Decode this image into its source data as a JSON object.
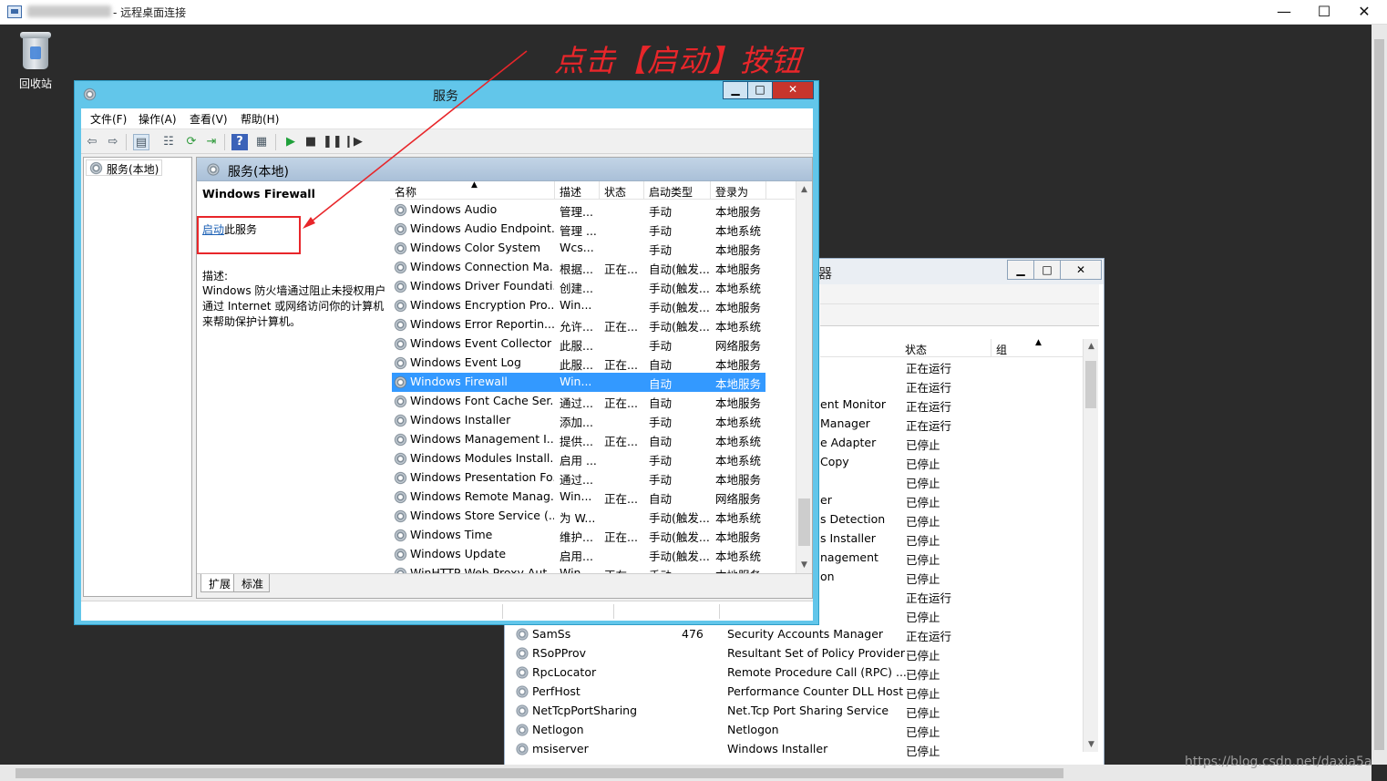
{
  "rdp": {
    "title": "- 远程桌面连接",
    "min": "—",
    "max": "☐",
    "close": "✕"
  },
  "desktop": {
    "recycle_bin_label": "回收站"
  },
  "annotation": {
    "text": "点击【启动】按钮",
    "color": "#e8262a"
  },
  "bg_window": {
    "title_fragment": "器",
    "min": "▁",
    "max": "□",
    "close": "✕",
    "col_status": "状态",
    "col_group": "组",
    "sort_arrow": "▲",
    "top_rows": [
      {
        "clip": "",
        "status": "正在运行"
      },
      {
        "clip": "",
        "status": "正在运行"
      },
      {
        "clip": "ent Monitor",
        "status": "正在运行"
      },
      {
        "clip": "Manager",
        "status": "正在运行"
      },
      {
        "clip": "e Adapter",
        "status": "已停止"
      },
      {
        "clip": "Copy",
        "status": "已停止"
      },
      {
        "clip": "",
        "status": "已停止"
      },
      {
        "clip": "er",
        "status": "已停止"
      },
      {
        "clip": "s Detection",
        "status": "已停止"
      },
      {
        "clip": "s Installer",
        "status": "已停止"
      },
      {
        "clip": "nagement",
        "status": "已停止"
      },
      {
        "clip": "on",
        "status": "已停止"
      },
      {
        "clip": "",
        "status": "正在运行"
      },
      {
        "clip": "",
        "status": "已停止"
      }
    ],
    "rows": [
      {
        "name": "SamSs",
        "pid": "476",
        "desc": "Security Accounts Manager",
        "status": "正在运行"
      },
      {
        "name": "RSoPProv",
        "pid": "",
        "desc": "Resultant Set of Policy Provider",
        "status": "已停止"
      },
      {
        "name": "RpcLocator",
        "pid": "",
        "desc": "Remote Procedure Call (RPC) ...",
        "status": "已停止"
      },
      {
        "name": "PerfHost",
        "pid": "",
        "desc": "Performance Counter DLL Host",
        "status": "已停止"
      },
      {
        "name": "NetTcpPortSharing",
        "pid": "",
        "desc": "Net.Tcp Port Sharing Service",
        "status": "已停止"
      },
      {
        "name": "Netlogon",
        "pid": "",
        "desc": "Netlogon",
        "status": "已停止"
      },
      {
        "name": "msiserver",
        "pid": "",
        "desc": "Windows Installer",
        "status": "已停止"
      }
    ]
  },
  "services": {
    "title": "服务",
    "min": "▁",
    "max": "□",
    "close": "✕",
    "menu": [
      "文件(F)",
      "操作(A)",
      "查看(V)",
      "帮助(H)"
    ],
    "tree_root": "服务(本地)",
    "pane_header": "服务(本地)",
    "detail": {
      "service_name": "Windows Firewall",
      "start_link": "启动",
      "start_suffix": "此服务",
      "desc_label": "描述:",
      "desc_text": "Windows 防火墙通过阻止未授权用户通过 Internet 或网络访问你的计算机来帮助保护计算机。"
    },
    "columns": {
      "name": "名称",
      "desc": "描述",
      "status": "状态",
      "startup": "启动类型",
      "logon": "登录为",
      "sort_arrow": "▲"
    },
    "rows": [
      {
        "name": "Windows Audio",
        "desc": "管理...",
        "status": "",
        "startup": "手动",
        "logon": "本地服务"
      },
      {
        "name": "Windows Audio Endpoint...",
        "desc": "管理 ...",
        "status": "",
        "startup": "手动",
        "logon": "本地系统"
      },
      {
        "name": "Windows Color System",
        "desc": "Wcs...",
        "status": "",
        "startup": "手动",
        "logon": "本地服务"
      },
      {
        "name": "Windows Connection Ma...",
        "desc": "根据...",
        "status": "正在...",
        "startup": "自动(触发...",
        "logon": "本地服务"
      },
      {
        "name": "Windows Driver Foundati...",
        "desc": "创建...",
        "status": "",
        "startup": "手动(触发...",
        "logon": "本地系统"
      },
      {
        "name": "Windows Encryption Pro...",
        "desc": "Win...",
        "status": "",
        "startup": "手动(触发...",
        "logon": "本地服务"
      },
      {
        "name": "Windows Error Reportin...",
        "desc": "允许...",
        "status": "正在...",
        "startup": "手动(触发...",
        "logon": "本地系统"
      },
      {
        "name": "Windows Event Collector",
        "desc": "此服...",
        "status": "",
        "startup": "手动",
        "logon": "网络服务"
      },
      {
        "name": "Windows Event Log",
        "desc": "此服...",
        "status": "正在...",
        "startup": "自动",
        "logon": "本地服务"
      },
      {
        "name": "Windows Firewall",
        "desc": "Win...",
        "status": "",
        "startup": "自动",
        "logon": "本地服务"
      },
      {
        "name": "Windows Font Cache Ser...",
        "desc": "通过...",
        "status": "正在...",
        "startup": "自动",
        "logon": "本地服务"
      },
      {
        "name": "Windows Installer",
        "desc": "添加...",
        "status": "",
        "startup": "手动",
        "logon": "本地系统"
      },
      {
        "name": "Windows Management I...",
        "desc": "提供...",
        "status": "正在...",
        "startup": "自动",
        "logon": "本地系统"
      },
      {
        "name": "Windows Modules Install...",
        "desc": "启用 ...",
        "status": "",
        "startup": "手动",
        "logon": "本地系统"
      },
      {
        "name": "Windows Presentation Fo...",
        "desc": "通过...",
        "status": "",
        "startup": "手动",
        "logon": "本地服务"
      },
      {
        "name": "Windows Remote Manag...",
        "desc": "Win...",
        "status": "正在...",
        "startup": "自动",
        "logon": "网络服务"
      },
      {
        "name": "Windows Store Service (...",
        "desc": "为 W...",
        "status": "",
        "startup": "手动(触发...",
        "logon": "本地系统"
      },
      {
        "name": "Windows Time",
        "desc": "维护...",
        "status": "正在...",
        "startup": "手动(触发...",
        "logon": "本地服务"
      },
      {
        "name": "Windows Update",
        "desc": "启用...",
        "status": "",
        "startup": "手动(触发...",
        "logon": "本地系统"
      },
      {
        "name": "WinHTTP Web Proxy Aut...",
        "desc": "Win...",
        "status": "正在...",
        "startup": "手动",
        "logon": "本地服务"
      }
    ],
    "selected_row": "Windows Firewall",
    "tabs": [
      "扩展",
      "标准"
    ]
  },
  "watermark": "https://blog.csdn.net/daxia5a",
  "colors": {
    "window_frame": "#62c6ea",
    "selection": "#3399ff",
    "annotation": "#e8262a"
  }
}
